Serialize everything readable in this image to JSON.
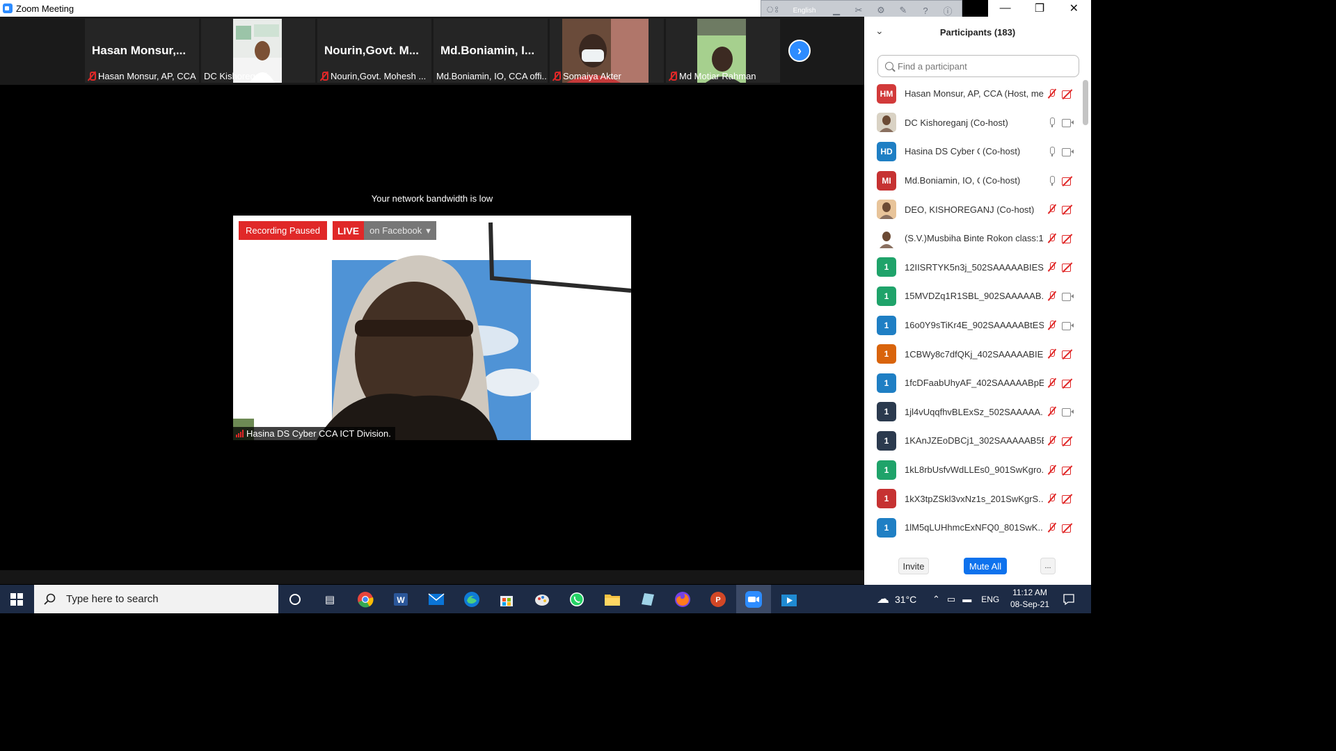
{
  "window": {
    "title": "Zoom Meeting"
  },
  "language_bar": {
    "language": "English"
  },
  "thumbnails": [
    {
      "big_name": "Hasan  Monsur,...",
      "label": "Hasan Monsur, AP, CCA",
      "muted": true
    },
    {
      "big_name": "",
      "label": "DC Kishoreganj",
      "muted": false
    },
    {
      "big_name": "Nourin,Govt.  M...",
      "label": "Nourin,Govt. Mohesh ...",
      "muted": true
    },
    {
      "big_name": "Md.Boniamin,  I...",
      "label": "Md.Boniamin, IO, CCA offi...",
      "muted": false
    },
    {
      "big_name": "",
      "label": "Somaiya Akter",
      "muted": true
    },
    {
      "big_name": "",
      "label": "Md Motiar Rahman",
      "muted": true
    }
  ],
  "main": {
    "bandwidth_warning": "Your network bandwidth is low",
    "recording_status": "Recording Paused",
    "live_label": "LIVE",
    "live_destination": "on Facebook",
    "speaker_name": "Hasina DS Cyber CCA ICT Division."
  },
  "participants_panel": {
    "title": "Participants (183)",
    "search_placeholder": "Find a participant",
    "items": [
      {
        "avatar": "HM",
        "color": "#d23a3a",
        "name": "Hasan Monsur, AP, CCA (Host, me)",
        "role": "",
        "mic": "off",
        "cam": "off"
      },
      {
        "avatar": "",
        "color": "#d9d2c4",
        "name": "DC Kishoreganj (Co-host)",
        "role": "",
        "mic": "on",
        "cam": "on"
      },
      {
        "avatar": "HD",
        "color": "#1f7fc4",
        "name": "Hasina DS Cyber CCA I...",
        "role": "(Co-host)",
        "mic": "on",
        "cam": "on"
      },
      {
        "avatar": "MI",
        "color": "#c63232",
        "name": "Md.Boniamin, IO, CCA ...",
        "role": "(Co-host)",
        "mic": "on",
        "cam": "off"
      },
      {
        "avatar": "",
        "color": "#e8c49a",
        "name": "DEO, KISHOREGANJ (Co-host)",
        "role": "",
        "mic": "off",
        "cam": "off"
      },
      {
        "avatar": "",
        "color": "#ffffff",
        "name": "(S.V.)Musbiha Binte Rokon class:1...",
        "role": "",
        "mic": "off",
        "cam": "off"
      },
      {
        "avatar": "1",
        "color": "#1fa36a",
        "name": "12IISRTYK5n3j_502SAAAAABIES...",
        "role": "",
        "mic": "off",
        "cam": "off"
      },
      {
        "avatar": "1",
        "color": "#1fa36a",
        "name": "15MVDZq1R1SBL_902SAAAAAB...",
        "role": "",
        "mic": "off",
        "cam": "on"
      },
      {
        "avatar": "1",
        "color": "#1f7fc4",
        "name": "16o0Y9sTiKr4E_902SAAAAABtES...",
        "role": "",
        "mic": "off",
        "cam": "on"
      },
      {
        "avatar": "1",
        "color": "#d9640c",
        "name": "1CBWy8c7dfQKj_402SAAAAABIE...",
        "role": "",
        "mic": "off",
        "cam": "off"
      },
      {
        "avatar": "1",
        "color": "#1f7fc4",
        "name": "1fcDFaabUhyAF_402SAAAAABpE...",
        "role": "",
        "mic": "off",
        "cam": "off"
      },
      {
        "avatar": "1",
        "color": "#2b3a4e",
        "name": "1jl4vUqqfhvBLExSz_502SAAAAA...",
        "role": "",
        "mic": "off",
        "cam": "on"
      },
      {
        "avatar": "1",
        "color": "#2b3a4e",
        "name": "1KAnJZEoDBCj1_302SAAAAAB5E...",
        "role": "",
        "mic": "off",
        "cam": "off"
      },
      {
        "avatar": "1",
        "color": "#1fa36a",
        "name": "1kL8rbUsfvWdLLEs0_901SwKgro...",
        "role": "",
        "mic": "off",
        "cam": "off"
      },
      {
        "avatar": "1",
        "color": "#c63232",
        "name": "1kX3tpZSkl3vxNz1s_201SwKgrS...",
        "role": "",
        "mic": "off",
        "cam": "off"
      },
      {
        "avatar": "1",
        "color": "#1f7fc4",
        "name": "1lM5qLUHhmcExNFQ0_801SwK...",
        "role": "",
        "mic": "off",
        "cam": "off"
      }
    ],
    "footer": {
      "invite": "Invite",
      "mute_all": "Mute All",
      "more": "..."
    }
  },
  "taskbar": {
    "search_placeholder": "Type here to search",
    "temperature": "31°C",
    "language": "ENG",
    "time": "11:12 AM",
    "date": "08-Sep-21"
  }
}
